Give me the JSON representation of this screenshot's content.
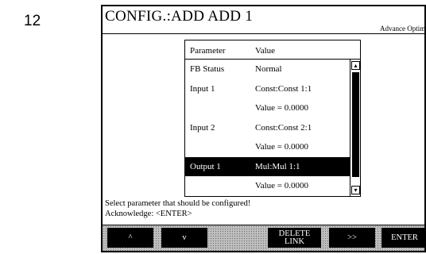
{
  "page_number": "12",
  "screen": {
    "title": "CONFIG.:ADD ADD 1",
    "mode_label": "Advance Optim."
  },
  "table": {
    "headers": {
      "parameter": "Parameter",
      "value": "Value"
    },
    "rows": [
      {
        "parameter": "FB Status",
        "value": "Normal",
        "selected": false
      },
      {
        "parameter": "Input 1",
        "value": "Const:Const 1:1",
        "selected": false
      },
      {
        "parameter": "",
        "value": "Value = 0.0000",
        "selected": false
      },
      {
        "parameter": "Input 2",
        "value": "Const:Const 2:1",
        "selected": false
      },
      {
        "parameter": "",
        "value": "Value = 0.0000",
        "selected": false
      },
      {
        "parameter": "Output 1",
        "value": "Mul:Mul 1:1",
        "selected": true
      },
      {
        "parameter": "",
        "value": "Value = 0.0000",
        "selected": false
      }
    ],
    "scroll_up_glyph": "▴",
    "scroll_down_glyph": "▾"
  },
  "hint": {
    "line1": "Select parameter that should be configured!",
    "line2": "Acknowledge: <ENTER>"
  },
  "softkeys": {
    "up": "^",
    "down": "v",
    "delete_line1": "DELETE",
    "delete_line2": "LINK",
    "next": ">>",
    "enter": "ENTER"
  }
}
